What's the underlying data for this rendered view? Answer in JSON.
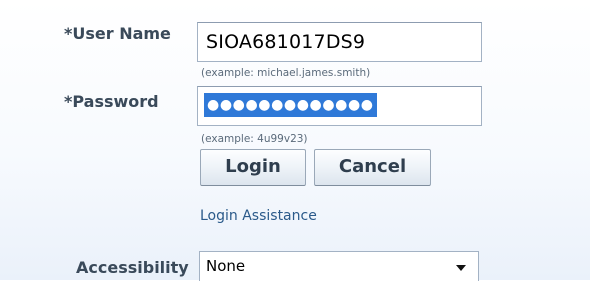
{
  "login_form": {
    "user_label": "*User Name",
    "user_value": "SIOA681017DS9",
    "user_hint": "(example: michael.james.smith)",
    "password_label": "*Password",
    "password_masked": "●●●●●●●●●●●●●",
    "password_hint": "(example: 4u99v23)",
    "login_button": "Login",
    "cancel_button": "Cancel",
    "assistance_link": "Login Assistance",
    "accessibility_label": "Accessibility",
    "accessibility_value": "None"
  },
  "colors": {
    "label_text": "#3a4a5a",
    "link": "#2a5a8a",
    "selection": "#2f79d8"
  },
  "icons": {
    "dropdown": "chevron-down-icon"
  }
}
